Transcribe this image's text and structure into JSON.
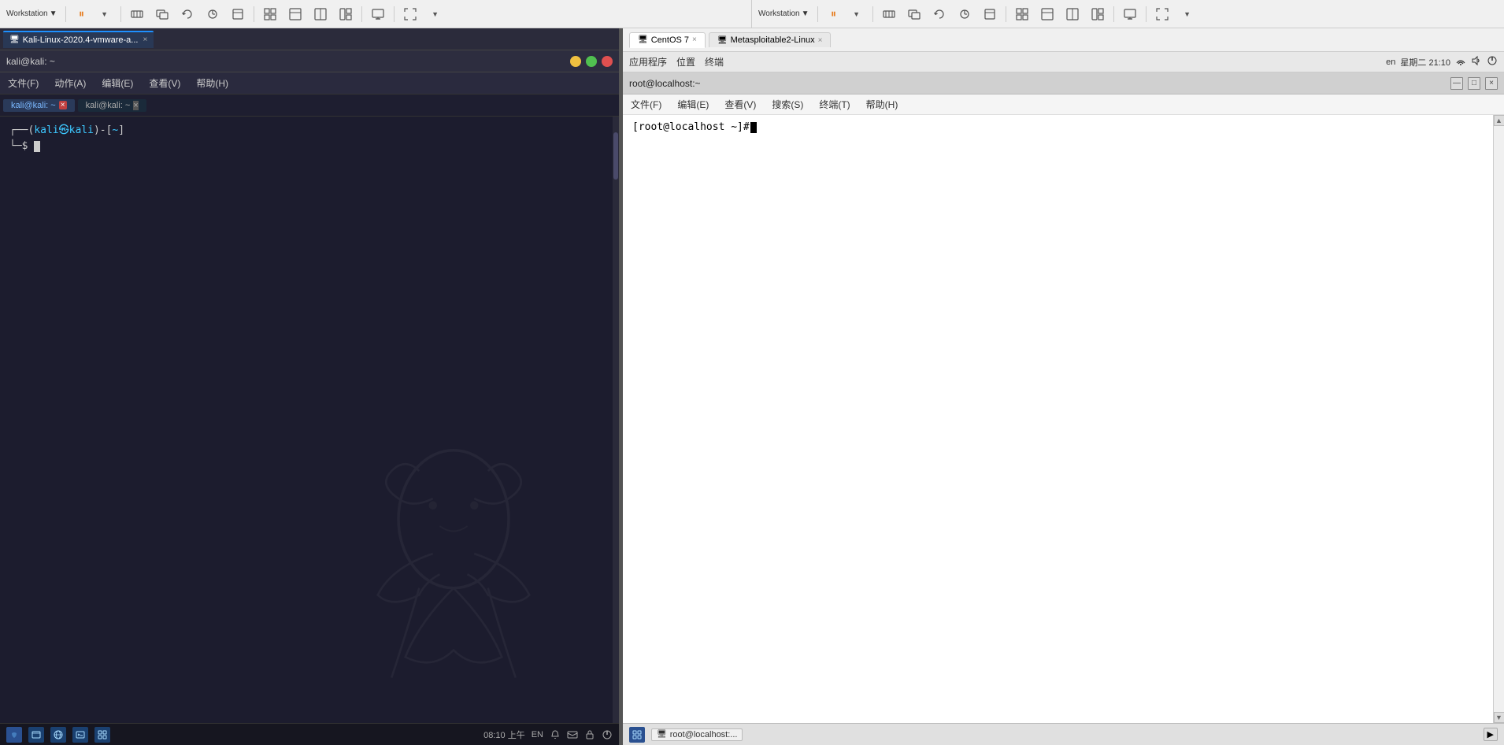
{
  "left_vm": {
    "topbar": {
      "workstation_label": "Workstation",
      "dropdown_arrow": "▼"
    },
    "vm_tab": {
      "title": "Kali-Linux-2020.4-vmware-a...",
      "close": "×"
    },
    "kali_window": {
      "title": "kali@kali: ~",
      "min_btn": "—",
      "max_btn": "□",
      "close_btn": "×"
    },
    "menubar": [
      {
        "label": "文件(F)"
      },
      {
        "label": "动作(A)"
      },
      {
        "label": "编辑(E)"
      },
      {
        "label": "查看(V)"
      },
      {
        "label": "帮助(H)"
      }
    ],
    "term_tab1": {
      "label": "kali@kali: ~",
      "close": "×"
    },
    "term_tab2": {
      "label": "kali@kali: ~",
      "close": "×"
    },
    "prompt": {
      "part1": "┌──(",
      "user": "kali㉿kali",
      "part2": ")-[",
      "path": "~",
      "part3": "]",
      "line2_arrow": "└─",
      "dollar": "$"
    },
    "taskbar": {
      "time": "08:10 上午",
      "lang": "EN"
    }
  },
  "right_vm": {
    "topbar": {
      "workstation_label": "Workstation",
      "dropdown_arrow": "▼"
    },
    "tabs": [
      {
        "label": "CentOS 7",
        "icon": "🖥",
        "close": "×",
        "active": true
      },
      {
        "label": "Metasploitable2-Linux",
        "icon": "🖥",
        "close": "×",
        "active": false
      }
    ],
    "centos_menubar": {
      "items": [
        "应用程序",
        "位置",
        "终端"
      ],
      "right_lang": "en",
      "right_datetime": "星期二 21:10",
      "right_icons": [
        "📶",
        "🔊",
        "⏻"
      ]
    },
    "terminal_window": {
      "title": "root@localhost:~",
      "min": "—",
      "max": "□",
      "close": "×"
    },
    "terminal_menubar": [
      {
        "label": "文件(F)"
      },
      {
        "label": "编辑(E)"
      },
      {
        "label": "查看(V)"
      },
      {
        "label": "搜索(S)"
      },
      {
        "label": "终端(T)"
      },
      {
        "label": "帮助(H)"
      }
    ],
    "prompt": {
      "text": "[root@localhost ~]# "
    },
    "taskbar": {
      "task_label": "root@localhost:..."
    }
  },
  "toolbar_icons": {
    "pause": "⏸",
    "send_ctrl_alt_del": "⎋",
    "snap": "📷",
    "full": "⛶"
  }
}
